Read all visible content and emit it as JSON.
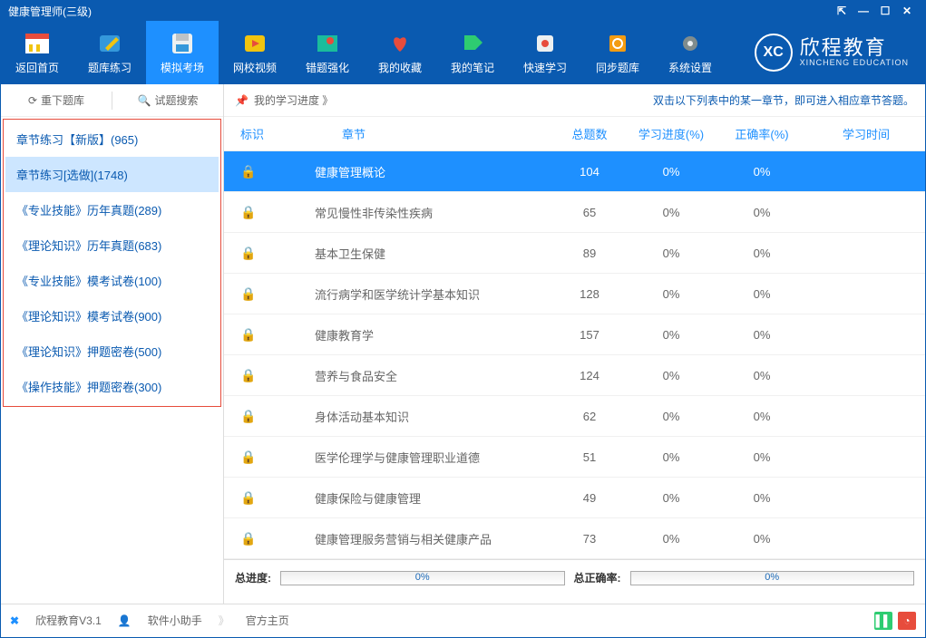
{
  "window": {
    "title": "健康管理师(三级)"
  },
  "nav": {
    "items": [
      {
        "label": "返回首页"
      },
      {
        "label": "题库练习"
      },
      {
        "label": "模拟考场"
      },
      {
        "label": "网校视频"
      },
      {
        "label": "错题强化"
      },
      {
        "label": "我的收藏"
      },
      {
        "label": "我的笔记"
      },
      {
        "label": "快速学习"
      },
      {
        "label": "同步题库"
      },
      {
        "label": "系统设置"
      }
    ],
    "brand_cn": "欣程教育",
    "brand_en": "XINCHENG EDUCATION",
    "brand_badge": "XC"
  },
  "sidebar": {
    "reload": "重下题库",
    "search": "试题搜索",
    "items": [
      {
        "label": "章节练习【新版】(965)"
      },
      {
        "label": "章节练习[选做](1748)"
      },
      {
        "label": "《专业技能》历年真题(289)"
      },
      {
        "label": "《理论知识》历年真题(683)"
      },
      {
        "label": "《专业技能》模考试卷(100)"
      },
      {
        "label": "《理论知识》模考试卷(900)"
      },
      {
        "label": "《理论知识》押题密卷(500)"
      },
      {
        "label": "《操作技能》押题密卷(300)"
      }
    ]
  },
  "topline": {
    "my_progress": "我的学习进度 》",
    "hint": "双击以下列表中的某一章节，即可进入相应章节答题。"
  },
  "columns": {
    "mark": "标识",
    "chapter": "章节",
    "total": "总题数",
    "progress": "学习进度(%)",
    "accuracy": "正确率(%)",
    "time": "学习时间"
  },
  "rows": [
    {
      "chapter": "健康管理概论",
      "total": "104",
      "progress": "0%",
      "accuracy": "0%"
    },
    {
      "chapter": "常见慢性非传染性疾病",
      "total": "65",
      "progress": "0%",
      "accuracy": "0%"
    },
    {
      "chapter": "基本卫生保健",
      "total": "89",
      "progress": "0%",
      "accuracy": "0%"
    },
    {
      "chapter": "流行病学和医学统计学基本知识",
      "total": "128",
      "progress": "0%",
      "accuracy": "0%"
    },
    {
      "chapter": "健康教育学",
      "total": "157",
      "progress": "0%",
      "accuracy": "0%"
    },
    {
      "chapter": "营养与食品安全",
      "total": "124",
      "progress": "0%",
      "accuracy": "0%"
    },
    {
      "chapter": "身体活动基本知识",
      "total": "62",
      "progress": "0%",
      "accuracy": "0%"
    },
    {
      "chapter": "医学伦理学与健康管理职业道德",
      "total": "51",
      "progress": "0%",
      "accuracy": "0%"
    },
    {
      "chapter": "健康保险与健康管理",
      "total": "49",
      "progress": "0%",
      "accuracy": "0%"
    },
    {
      "chapter": "健康管理服务营销与相关健康产品",
      "total": "73",
      "progress": "0%",
      "accuracy": "0%"
    }
  ],
  "totals": {
    "total_progress_label": "总进度:",
    "total_progress_pct": "0%",
    "total_accuracy_label": "总正确率:",
    "total_accuracy_pct": "0%"
  },
  "status": {
    "app": "欣程教育V3.1",
    "helper": "软件小助手",
    "home": "官方主页",
    "arrow": "》"
  },
  "colors": {
    "primary": "#0a5ab0",
    "accent": "#1e90ff"
  }
}
